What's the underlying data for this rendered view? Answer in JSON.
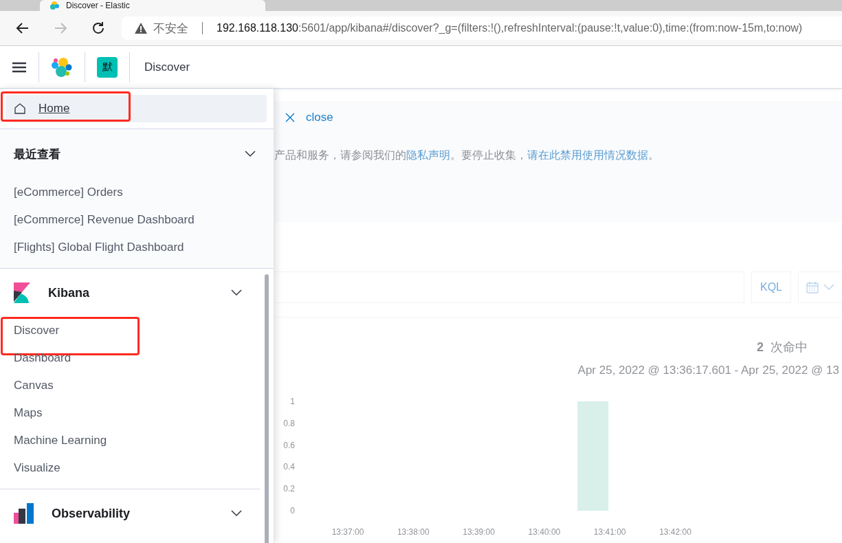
{
  "browser": {
    "tab_title": "Discover - Elastic",
    "insecure_label": "不安全",
    "url_host": "192.168.118.130",
    "url_rest": ":5601/app/kibana#/discover?_g=(filters:!(),refreshInterval:(pause:!t,value:0),time:(from:now-15m,to:now)"
  },
  "header": {
    "space_badge": "默",
    "breadcrumb": "Discover"
  },
  "nav": {
    "home": {
      "label": "Home",
      "selected": true,
      "highlighted": true
    },
    "recent": {
      "title": "最近查看",
      "items": [
        "[eCommerce] Orders",
        "[eCommerce] Revenue Dashboard",
        "[Flights] Global Flight Dashboard"
      ]
    },
    "groups": [
      {
        "kind": "kibana",
        "title": "Kibana",
        "items": [
          {
            "label": "Discover",
            "highlighted": true
          },
          {
            "label": "Dashboard",
            "highlighted": false
          },
          {
            "label": "Canvas",
            "highlighted": false
          },
          {
            "label": "Maps",
            "highlighted": false
          },
          {
            "label": "Machine Learning",
            "highlighted": false
          },
          {
            "label": "Visualize",
            "highlighted": false
          }
        ]
      },
      {
        "kind": "observability",
        "title": "Observability"
      }
    ]
  },
  "callout": {
    "close": "close",
    "parts": [
      {
        "kind": "text",
        "text": "产品和服务，请参阅我们的"
      },
      {
        "kind": "link",
        "text": "隐私声明"
      },
      {
        "kind": "text",
        "text": "。要停止收集，"
      },
      {
        "kind": "link",
        "text": "请在此禁用使用情况数据"
      },
      {
        "kind": "text",
        "text": "。"
      }
    ]
  },
  "query": {
    "language": "KQL"
  },
  "hits": {
    "count": "2",
    "label": "次命中",
    "range": "Apr 25, 2022 @ 13:36:17.601 - Apr 25, 2022 @ 13"
  },
  "histogram": {
    "chart_data": {
      "type": "bar",
      "categories": [
        "13:37:00",
        "13:38:00",
        "13:39:00",
        "13:40:00",
        "13:41:00",
        "13:42:00"
      ],
      "series": [
        {
          "color": "#d8efea",
          "values": [
            0,
            0,
            0,
            0,
            1,
            0
          ]
        }
      ],
      "ylim": [
        0,
        1
      ],
      "yticks": [
        0,
        0.2,
        0.4,
        0.6,
        0.8,
        1
      ]
    }
  }
}
